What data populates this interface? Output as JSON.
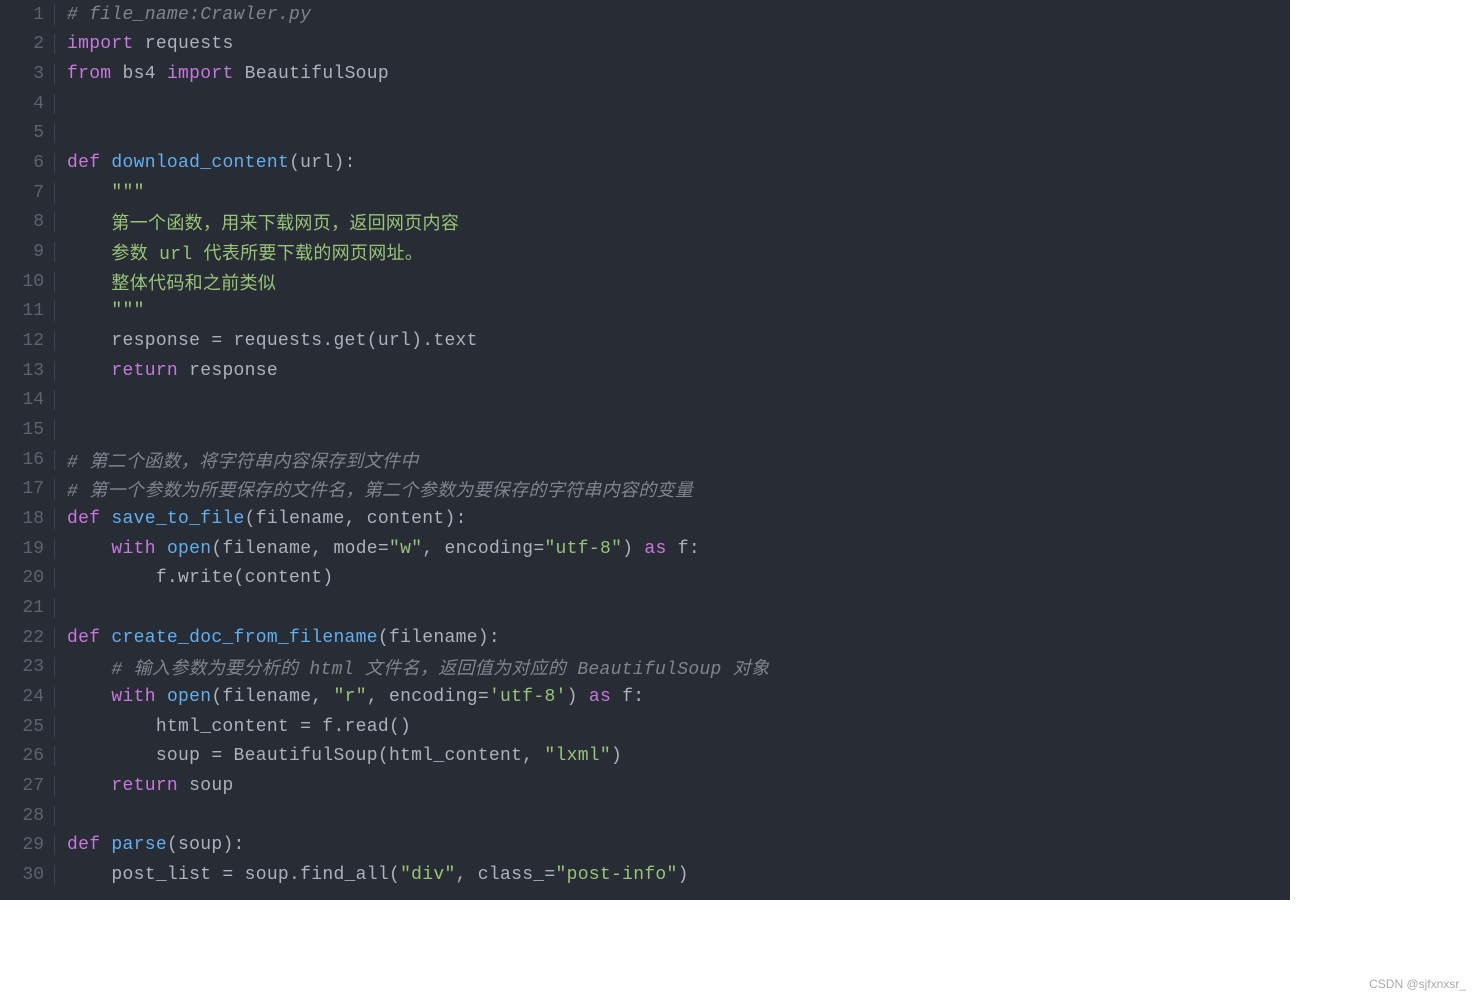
{
  "watermark": "CSDN @sjfxnxsr_",
  "lines": [
    {
      "n": "1",
      "html": "<span class='c'># file_name:Crawler.py</span>"
    },
    {
      "n": "2",
      "html": "<span class='kw'>import</span><span class='nm'> requests</span>"
    },
    {
      "n": "3",
      "html": "<span class='kw'>from</span><span class='nm'> bs4 </span><span class='kw'>import</span><span class='nm'> BeautifulSoup</span>"
    },
    {
      "n": "4",
      "html": ""
    },
    {
      "n": "5",
      "html": ""
    },
    {
      "n": "6",
      "html": "<span class='kw'>def</span><span class='nm'> </span><span class='fn'>download_content</span><span class='p'>(url):</span>"
    },
    {
      "n": "7",
      "html": "<span class='nm'>    </span><span class='s'>\"\"\"</span>"
    },
    {
      "n": "8",
      "html": "<span class='nm'>    </span><span class='s'>第一个函数，用来下载网页，返回网页内容</span>"
    },
    {
      "n": "9",
      "html": "<span class='nm'>    </span><span class='s'>参数 url 代表所要下载的网页网址。</span>"
    },
    {
      "n": "10",
      "html": "<span class='nm'>    </span><span class='s'>整体代码和之前类似</span>"
    },
    {
      "n": "11",
      "html": "<span class='nm'>    </span><span class='s'>\"\"\"</span>"
    },
    {
      "n": "12",
      "html": "<span class='nm'>    response = requests.get(url).text</span>"
    },
    {
      "n": "13",
      "html": "<span class='nm'>    </span><span class='kw'>return</span><span class='nm'> response</span>"
    },
    {
      "n": "14",
      "html": ""
    },
    {
      "n": "15",
      "html": ""
    },
    {
      "n": "16",
      "html": "<span class='c'># 第二个函数，将字符串内容保存到文件中</span>"
    },
    {
      "n": "17",
      "html": "<span class='c'># 第一个参数为所要保存的文件名，第二个参数为要保存的字符串内容的变量</span>"
    },
    {
      "n": "18",
      "html": "<span class='kw'>def</span><span class='nm'> </span><span class='fn'>save_to_file</span><span class='p'>(filename, content):</span>"
    },
    {
      "n": "19",
      "html": "<span class='nm'>    </span><span class='kw'>with</span><span class='nm'> </span><span class='fn'>open</span><span class='p'>(filename, mode=</span><span class='s'>\"w\"</span><span class='p'>, encoding=</span><span class='s'>\"utf-8\"</span><span class='p'>) </span><span class='kw'>as</span><span class='nm'> f:</span>"
    },
    {
      "n": "20",
      "html": "<span class='nm'>        f.write(content)</span>"
    },
    {
      "n": "21",
      "html": ""
    },
    {
      "n": "22",
      "html": "<span class='kw'>def</span><span class='nm'> </span><span class='fn'>create_doc_from_filename</span><span class='p'>(filename):</span>"
    },
    {
      "n": "23",
      "html": "<span class='nm'>    </span><span class='c'># 输入参数为要分析的 html 文件名，返回值为对应的 BeautifulSoup 对象</span>"
    },
    {
      "n": "24",
      "html": "<span class='nm'>    </span><span class='kw'>with</span><span class='nm'> </span><span class='fn'>open</span><span class='p'>(filename, </span><span class='s'>\"r\"</span><span class='p'>, encoding=</span><span class='s'>'utf-8'</span><span class='p'>) </span><span class='kw'>as</span><span class='nm'> f:</span>"
    },
    {
      "n": "25",
      "html": "<span class='nm'>        html_content = f.read()</span>"
    },
    {
      "n": "26",
      "html": "<span class='nm'>        soup = BeautifulSoup(html_content, </span><span class='s'>\"lxml\"</span><span class='p'>)</span>"
    },
    {
      "n": "27",
      "html": "<span class='nm'>    </span><span class='kw'>return</span><span class='nm'> soup</span>"
    },
    {
      "n": "28",
      "html": ""
    },
    {
      "n": "29",
      "html": "<span class='kw'>def</span><span class='nm'> </span><span class='fn'>parse</span><span class='p'>(soup):</span>"
    },
    {
      "n": "30",
      "html": "<span class='nm'>    post_list = soup.find_all(</span><span class='s'>\"div\"</span><span class='p'>, class_=</span><span class='s'>\"post-info\"</span><span class='p'>)</span>"
    }
  ]
}
